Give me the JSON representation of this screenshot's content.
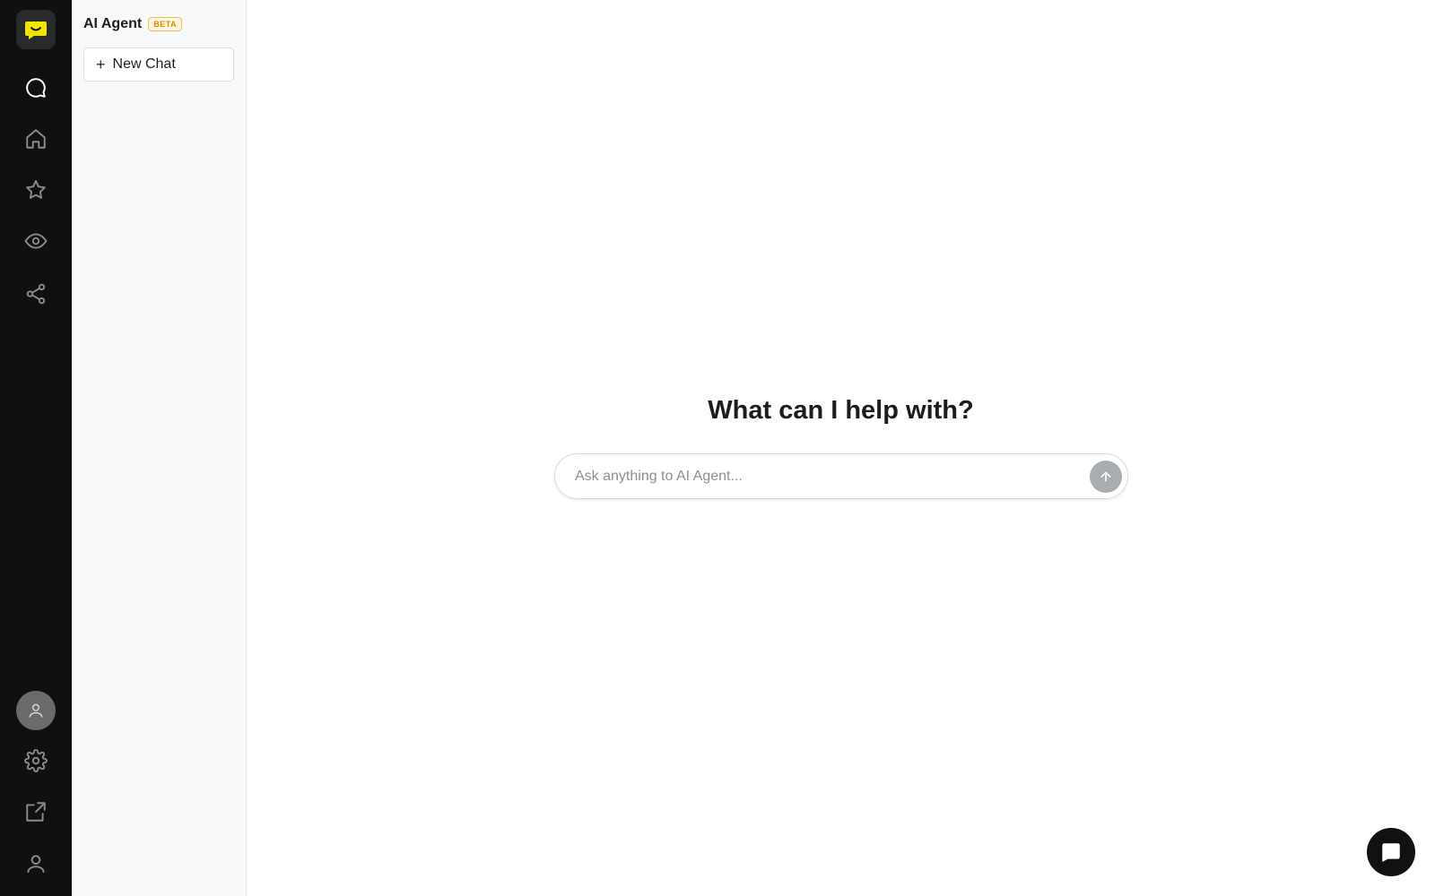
{
  "rail": {
    "items": [
      {
        "icon": "chat-bubble-icon",
        "label": "Chat",
        "active": true
      },
      {
        "icon": "home-icon",
        "label": "Home"
      },
      {
        "icon": "star-icon",
        "label": "Favorites"
      },
      {
        "icon": "eye-icon",
        "label": "Watch"
      },
      {
        "icon": "share-icon",
        "label": "Share"
      }
    ],
    "bottom": [
      {
        "icon": "avatar-icon"
      },
      {
        "icon": "gear-icon"
      },
      {
        "icon": "external-link-icon"
      },
      {
        "icon": "user-icon"
      }
    ],
    "logo_color": "#f2e600"
  },
  "sidebar": {
    "title": "AI Agent",
    "badge": "BETA",
    "new_chat_label": "New Chat"
  },
  "main": {
    "headline": "What can I help with?",
    "prompt_placeholder": "Ask anything to AI Agent..."
  },
  "colors": {
    "rail_bg": "#101010",
    "sidebar_bg": "#f8f9fb",
    "badge_color": "#e08a00",
    "send_button": "#a9acb0"
  }
}
